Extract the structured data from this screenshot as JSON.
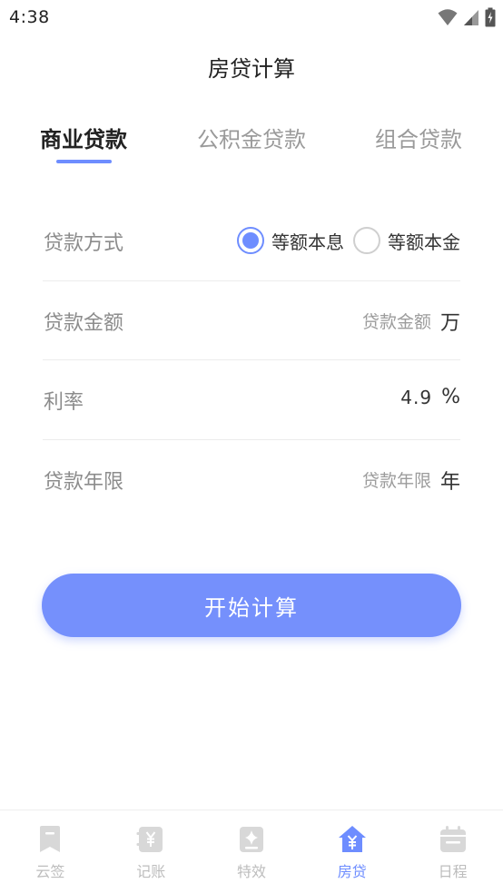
{
  "status_bar": {
    "time": "4:38"
  },
  "header": {
    "title": "房贷计算"
  },
  "tabs": [
    {
      "label": "商业贷款",
      "active": true
    },
    {
      "label": "公积金贷款",
      "active": false
    },
    {
      "label": "组合贷款",
      "active": false
    }
  ],
  "form": {
    "method": {
      "label": "贷款方式",
      "options": [
        {
          "label": "等额本息",
          "checked": true
        },
        {
          "label": "等额本金",
          "checked": false
        }
      ]
    },
    "amount": {
      "label": "贷款金额",
      "placeholder": "贷款金额",
      "unit": "万"
    },
    "rate": {
      "label": "利率",
      "value": "4.9",
      "unit": "%"
    },
    "term": {
      "label": "贷款年限",
      "placeholder": "贷款年限",
      "unit": "年"
    }
  },
  "calculate_button": {
    "label": "开始计算"
  },
  "bottom_nav": [
    {
      "label": "云签",
      "icon": "bookmark-icon",
      "active": false
    },
    {
      "label": "记账",
      "icon": "yuan-ledger-icon",
      "active": false
    },
    {
      "label": "特效",
      "icon": "sparkle-icon",
      "active": false
    },
    {
      "label": "房贷",
      "icon": "house-yuan-icon",
      "active": true
    },
    {
      "label": "日程",
      "icon": "calendar-icon",
      "active": false
    }
  ],
  "colors": {
    "accent": "#6e8dff",
    "button": "#7590fc",
    "inactive_nav": "#d8d8d8"
  }
}
